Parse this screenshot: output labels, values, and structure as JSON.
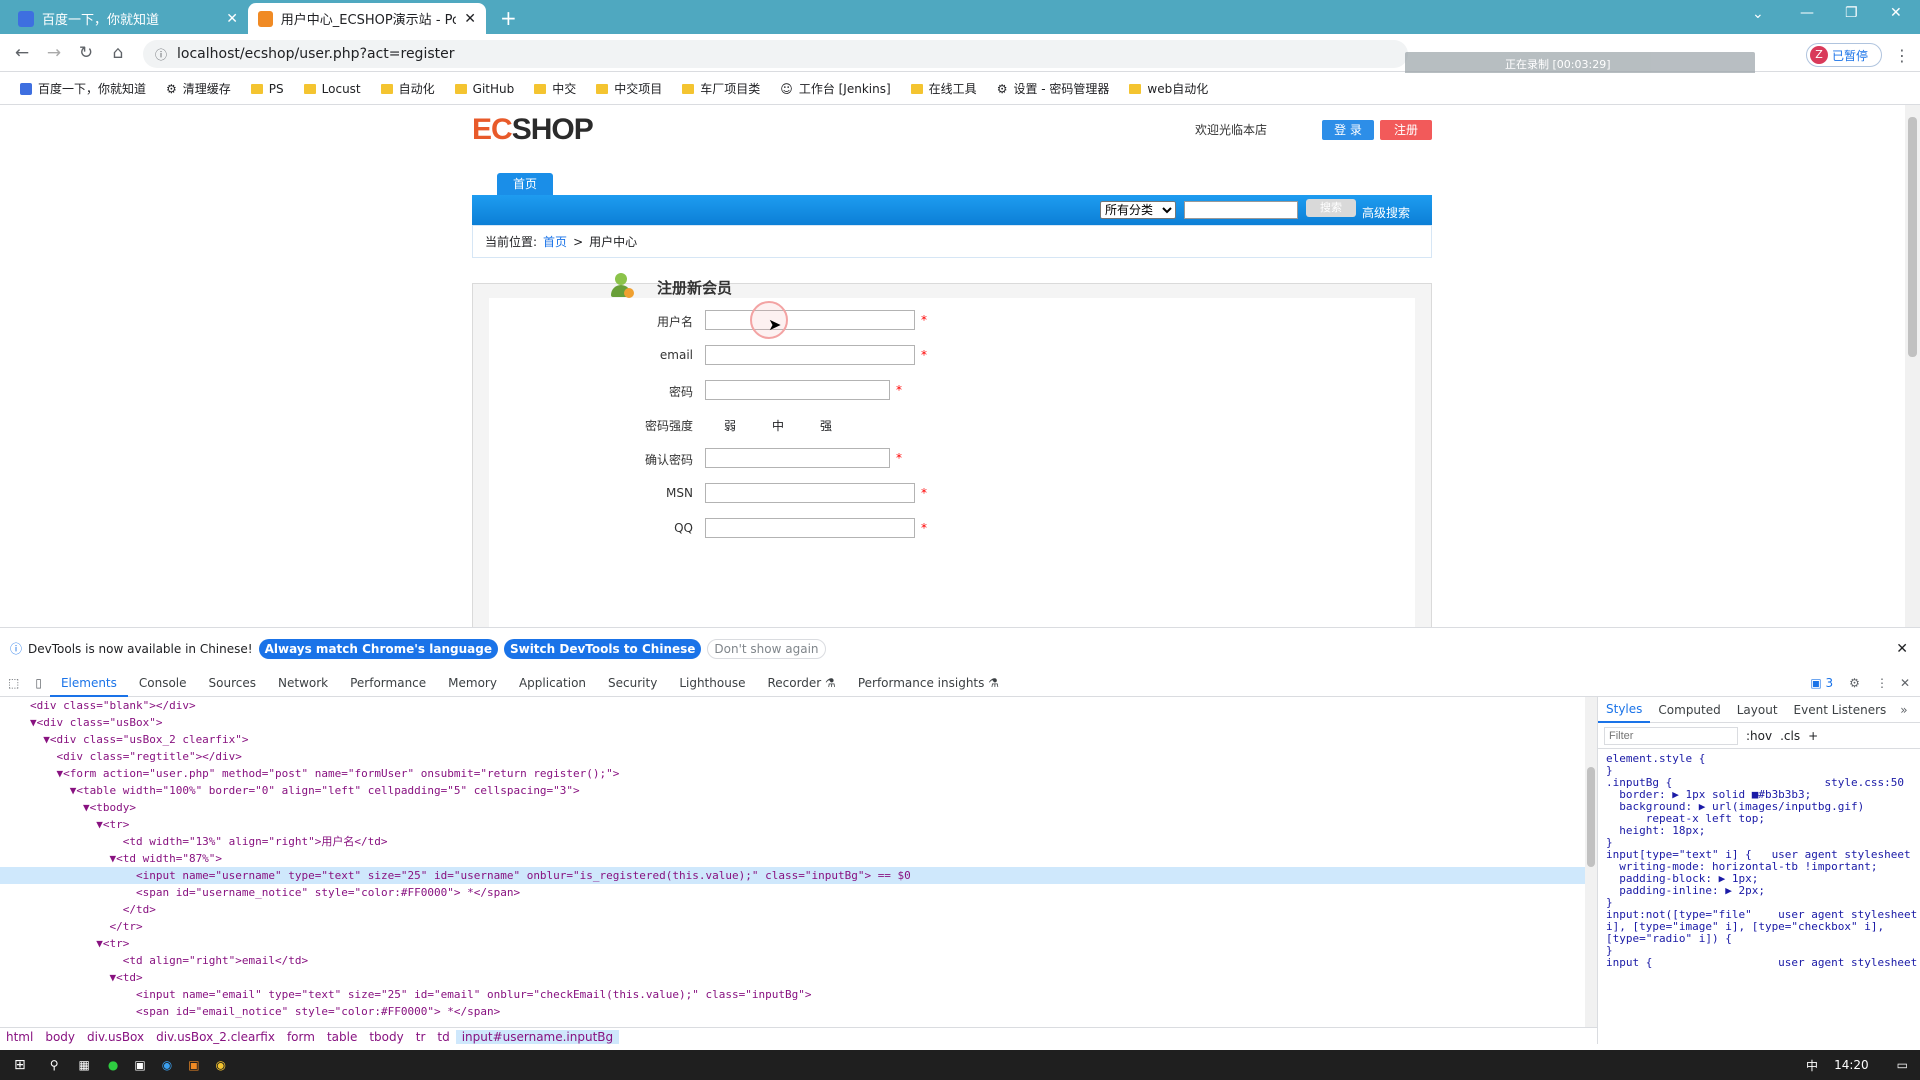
{
  "browser": {
    "tabs": [
      {
        "title": "百度一下，你就知道",
        "active": false
      },
      {
        "title": "用户中心_ECSHOP演示站 - Pow",
        "active": true
      }
    ],
    "new_tab": "+",
    "url": "localhost/ecshop/user.php?act=register",
    "recording": "正在录制 [00:03:29]",
    "profile_badge": "已暂停",
    "profile_letter": "Z"
  },
  "bookmarks": [
    "百度一下，你就知道",
    "清理缓存",
    "PS",
    "Locust",
    "自动化",
    "GitHub",
    "中交",
    "中交项目",
    "车厂项目类",
    "工作台 [Jenkins]",
    "在线工具",
    "设置 - 密码管理器",
    "web自动化"
  ],
  "site": {
    "logo": "ECSHOP",
    "welcome": "欢迎光临本店",
    "login": "登 录",
    "register": "注册",
    "home_tab": "首页",
    "category_select": "所有分类",
    "search_button": "搜索",
    "advanced_search": "高级搜索",
    "breadcrumb_prefix": "当前位置:",
    "breadcrumb_home": "首页",
    "breadcrumb_sep": ">",
    "breadcrumb_current": "用户中心",
    "form_title": "注册新会员",
    "fields": {
      "username": "用户名",
      "email": "email",
      "password": "密码",
      "strength": "密码强度",
      "confirm": "确认密码",
      "msn": "MSN",
      "qq": "QQ"
    },
    "strength_levels": [
      "弱",
      "中",
      "强"
    ],
    "required_mark": "*"
  },
  "devtools": {
    "info_text": "DevTools is now available in Chinese!",
    "btn_match": "Always match Chrome's language",
    "btn_switch": "Switch DevTools to Chinese",
    "btn_dismiss": "Don't show again",
    "tabs": [
      "Elements",
      "Console",
      "Sources",
      "Network",
      "Performance",
      "Memory",
      "Application",
      "Security",
      "Lighthouse",
      "Recorder ⚗",
      "Performance insights ⚗"
    ],
    "issues_count": "3",
    "style_tabs": [
      "Styles",
      "Computed",
      "Layout",
      "Event Listeners"
    ],
    "filter_placeholder": "Filter",
    "hov": ":hov",
    "cls": ".cls",
    "dom_lines": [
      "<div class=\"blank\"></div>",
      "▼<div class=\"usBox\">",
      "  ▼<div class=\"usBox_2 clearfix\">",
      "    <div class=\"regtitle\"></div>",
      "    ▼<form action=\"user.php\" method=\"post\" name=\"formUser\" onsubmit=\"return register();\">",
      "      ▼<table width=\"100%\" border=\"0\" align=\"left\" cellpadding=\"5\" cellspacing=\"3\">",
      "        ▼<tbody>",
      "          ▼<tr>",
      "              <td width=\"13%\" align=\"right\">用户名</td>",
      "            ▼<td width=\"87%\">",
      "                <input name=\"username\" type=\"text\" size=\"25\" id=\"username\" onblur=\"is_registered(this.value);\" class=\"inputBg\"> == $0",
      "                <span id=\"username_notice\" style=\"color:#FF0000\"> *</span>",
      "              </td>",
      "            </tr>",
      "          ▼<tr>",
      "              <td align=\"right\">email</td>",
      "            ▼<td>",
      "                <input name=\"email\" type=\"text\" size=\"25\" id=\"email\" onblur=\"checkEmail(this.value);\" class=\"inputBg\">",
      "                <span id=\"email_notice\" style=\"color:#FF0000\"> *</span>"
    ],
    "css_lines": [
      "element.style {",
      "}",
      ".inputBg {                       style.css:50",
      "  border: ▶ 1px solid ■#b3b3b3;",
      "  background: ▶ url(images/inputbg.gif)",
      "      repeat-x left top;",
      "  height: 18px;",
      "}",
      "input[type=\"text\" i] {   user agent stylesheet",
      "  writing-mode: horizontal-tb !important;",
      "  padding-block: ▶ 1px;",
      "  padding-inline: ▶ 2px;",
      "}",
      "input:not([type=\"file\"    user agent stylesheet",
      "i], [type=\"image\" i], [type=\"checkbox\" i],",
      "[type=\"radio\" i]) {",
      "}",
      "input {                   user agent stylesheet"
    ],
    "breadcrumbs": [
      "html",
      "body",
      "div.usBox",
      "div.usBox_2.clearfix",
      "form",
      "table",
      "tbody",
      "tr",
      "td",
      "input#username.inputBg"
    ]
  },
  "taskbar": {
    "time": "14:20",
    "ime": "中"
  }
}
